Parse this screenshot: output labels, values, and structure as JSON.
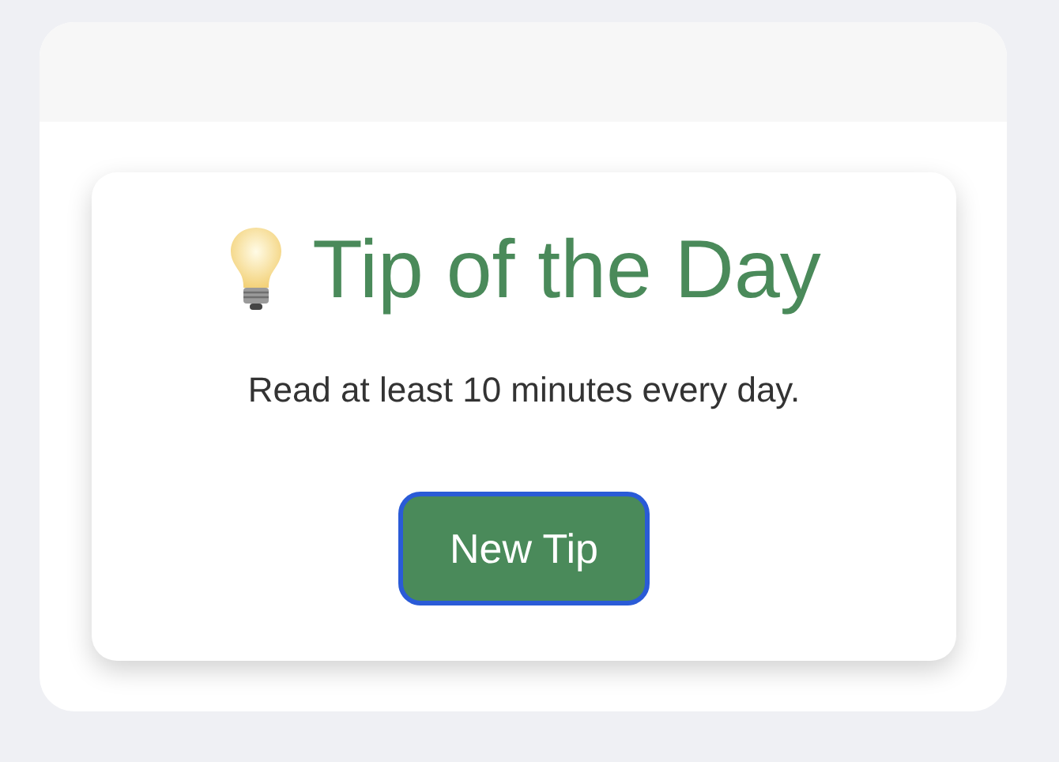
{
  "card": {
    "title": "Tip of the Day",
    "tip": "Read at least 10 minutes every day.",
    "button": {
      "label": "New Tip",
      "focused": true
    }
  }
}
